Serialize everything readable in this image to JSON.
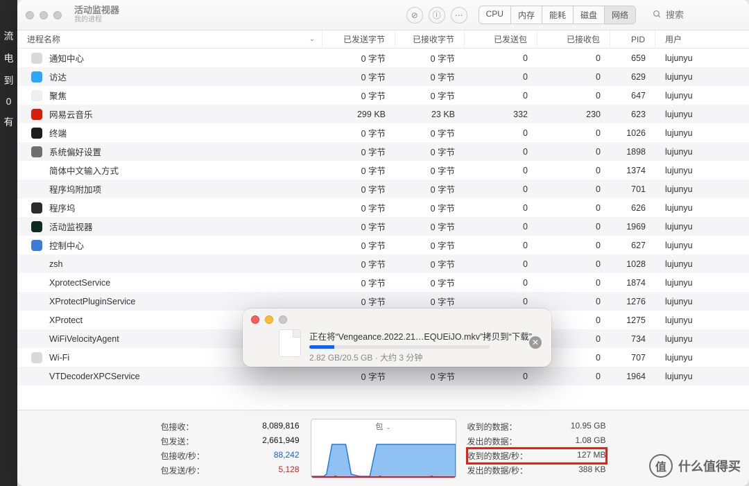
{
  "app": {
    "title": "活动监视器",
    "subtitle": "我的进程"
  },
  "toolbar": {
    "tabs": [
      "CPU",
      "内存",
      "能耗",
      "磁盘",
      "网络"
    ],
    "active_tab": 4,
    "search_placeholder": "搜索"
  },
  "columns": {
    "name": "进程名称",
    "sent_bytes": "已发送字节",
    "recv_bytes": "已接收字节",
    "sent_pkts": "已发送包",
    "recv_pkts": "已接收包",
    "pid": "PID",
    "user": "用户"
  },
  "rows": [
    {
      "icon": "#d9d9d9",
      "name": "通知中心",
      "sb": "0 字节",
      "rb": "0 字节",
      "sp": "0",
      "rp": "0",
      "pid": "659",
      "user": "lujunyu"
    },
    {
      "icon": "#2aa7ff",
      "name": "访达",
      "sb": "0 字节",
      "rb": "0 字节",
      "sp": "0",
      "rp": "0",
      "pid": "629",
      "user": "lujunyu"
    },
    {
      "icon": "#eeeeee",
      "name": "聚焦",
      "sb": "0 字节",
      "rb": "0 字节",
      "sp": "0",
      "rp": "0",
      "pid": "647",
      "user": "lujunyu"
    },
    {
      "icon": "#d81e06",
      "name": "网易云音乐",
      "sb": "299 KB",
      "rb": "23 KB",
      "sp": "332",
      "rp": "230",
      "pid": "623",
      "user": "lujunyu"
    },
    {
      "icon": "#1c1c1c",
      "name": "终端",
      "sb": "0 字节",
      "rb": "0 字节",
      "sp": "0",
      "rp": "0",
      "pid": "1026",
      "user": "lujunyu"
    },
    {
      "icon": "#6e6e6e",
      "name": "系统偏好设置",
      "sb": "0 字节",
      "rb": "0 字节",
      "sp": "0",
      "rp": "0",
      "pid": "1898",
      "user": "lujunyu"
    },
    {
      "icon": "",
      "name": "简体中文输入方式",
      "sb": "0 字节",
      "rb": "0 字节",
      "sp": "0",
      "rp": "0",
      "pid": "1374",
      "user": "lujunyu"
    },
    {
      "icon": "",
      "name": "程序坞附加项",
      "sb": "0 字节",
      "rb": "0 字节",
      "sp": "0",
      "rp": "0",
      "pid": "701",
      "user": "lujunyu"
    },
    {
      "icon": "#2c2c2c",
      "name": "程序坞",
      "sb": "0 字节",
      "rb": "0 字节",
      "sp": "0",
      "rp": "0",
      "pid": "626",
      "user": "lujunyu"
    },
    {
      "icon": "#0b2b23",
      "name": "活动监视器",
      "sb": "0 字节",
      "rb": "0 字节",
      "sp": "0",
      "rp": "0",
      "pid": "1969",
      "user": "lujunyu"
    },
    {
      "icon": "#3d7bd9",
      "name": "控制中心",
      "sb": "0 字节",
      "rb": "0 字节",
      "sp": "0",
      "rp": "0",
      "pid": "627",
      "user": "lujunyu"
    },
    {
      "icon": "",
      "name": "zsh",
      "sb": "0 字节",
      "rb": "0 字节",
      "sp": "0",
      "rp": "0",
      "pid": "1028",
      "user": "lujunyu"
    },
    {
      "icon": "",
      "name": "XprotectService",
      "sb": "0 字节",
      "rb": "0 字节",
      "sp": "0",
      "rp": "0",
      "pid": "1874",
      "user": "lujunyu"
    },
    {
      "icon": "",
      "name": "XProtectPluginService",
      "sb": "0 字节",
      "rb": "0 字节",
      "sp": "0",
      "rp": "0",
      "pid": "1276",
      "user": "lujunyu"
    },
    {
      "icon": "",
      "name": "XProtect",
      "sb": "",
      "rb": "",
      "sp": "0",
      "rp": "0",
      "pid": "1275",
      "user": "lujunyu"
    },
    {
      "icon": "",
      "name": "WiFiVelocityAgent",
      "sb": "",
      "rb": "",
      "sp": "0",
      "rp": "0",
      "pid": "734",
      "user": "lujunyu"
    },
    {
      "icon": "#d9d9d9",
      "name": "Wi-Fi",
      "sb": "",
      "rb": "",
      "sp": "0",
      "rp": "0",
      "pid": "707",
      "user": "lujunyu"
    },
    {
      "icon": "",
      "name": "VTDecoderXPCService",
      "sb": "0 字节",
      "rb": "0 字节",
      "sp": "0",
      "rp": "0",
      "pid": "1964",
      "user": "lujunyu"
    }
  ],
  "footer": {
    "left": {
      "pkts_in_label": "包接收：",
      "pkts_in": "8,089,816",
      "pkts_out_label": "包发送：",
      "pkts_out": "2,661,949",
      "pkts_in_s_label": "包接收/秒：",
      "pkts_in_s": "88,242",
      "pkts_out_s_label": "包发送/秒：",
      "pkts_out_s": "5,128"
    },
    "graph_label": "包",
    "right": {
      "data_in_label": "收到的数据：",
      "data_in": "10.95 GB",
      "data_out_label": "发出的数据：",
      "data_out": "1.08 GB",
      "data_in_s_label": "收到的数据/秒：",
      "data_in_s": "127 MB",
      "data_out_s_label": "发出的数据/秒：",
      "data_out_s": "388 KB"
    }
  },
  "popup": {
    "title": "正在将“Vengeance.2022.21…EQUEiJO.mkv”拷贝到“下载”",
    "progress_text": "2.82 GB/20.5 GB · 大约 3 分钟",
    "progress_pct": 14
  },
  "watermark": "什么值得买",
  "chart_data": {
    "type": "area",
    "title": "包",
    "series": [
      {
        "name": "包接收/秒",
        "color": "#1f7ae0",
        "values": [
          5,
          8,
          60,
          60,
          8,
          5,
          60,
          60,
          60,
          60,
          62,
          58,
          60,
          60
        ]
      },
      {
        "name": "包发送/秒",
        "color": "#d6201f",
        "values": [
          2,
          2,
          4,
          4,
          2,
          2,
          3,
          4,
          3,
          3,
          4,
          3,
          4,
          4
        ]
      }
    ],
    "xlabel": "",
    "ylabel": "",
    "ylim": [
      0,
      65
    ]
  }
}
